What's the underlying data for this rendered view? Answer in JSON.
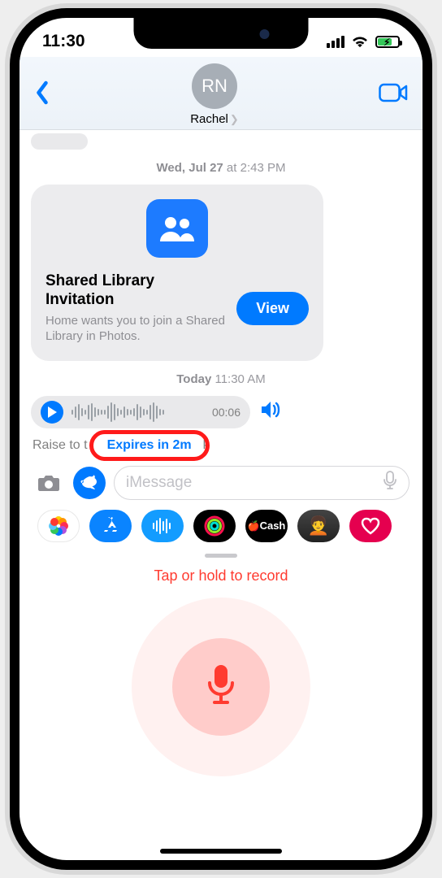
{
  "status": {
    "time": "11:30"
  },
  "header": {
    "avatar_initials": "RN",
    "contact_name": "Rachel"
  },
  "timestamps": {
    "t1_day": "Wed, Jul 27",
    "t1_time": " at 2:43 PM",
    "t2_day": "Today",
    "t2_time": " 11:30 AM"
  },
  "invite": {
    "title": "Shared Library Invitation",
    "subtitle": "Home wants you to join a Shared Library in Photos.",
    "button": "View"
  },
  "audio": {
    "duration": "00:06"
  },
  "under_audio": {
    "raise_left": "Raise to t",
    "raise_right": "k",
    "expires": "Expires in 2m"
  },
  "compose": {
    "placeholder": "iMessage"
  },
  "apps": {
    "cash_label": "Cash"
  },
  "record": {
    "label": "Tap or hold to record"
  }
}
